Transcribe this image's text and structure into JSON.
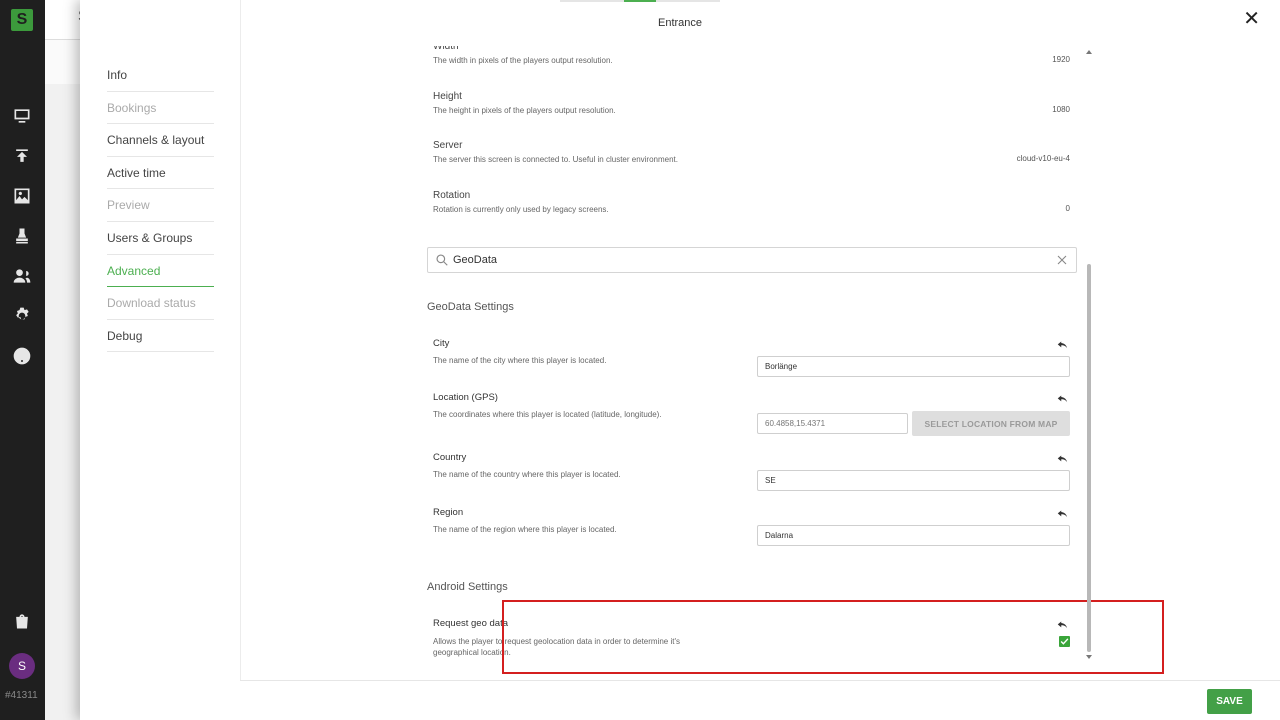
{
  "app": {
    "logo_letter": "S",
    "avatar_letter": "S",
    "account_id": "#41311"
  },
  "background": {
    "header_char": "S"
  },
  "modal": {
    "title": "Entrance",
    "close_label": "✕"
  },
  "left_nav": {
    "items": [
      {
        "label": "Info",
        "state": "normal"
      },
      {
        "label": "Bookings",
        "state": "disabled"
      },
      {
        "label": "Channels & layout",
        "state": "normal"
      },
      {
        "label": "Active time",
        "state": "normal"
      },
      {
        "label": "Preview",
        "state": "disabled"
      },
      {
        "label": "Users & Groups",
        "state": "normal"
      },
      {
        "label": "Advanced",
        "state": "active"
      },
      {
        "label": "Download status",
        "state": "disabled"
      },
      {
        "label": "Debug",
        "state": "normal"
      }
    ]
  },
  "settings": {
    "width": {
      "label": "Width",
      "description": "The width in pixels of the players output resolution.",
      "value": "1920"
    },
    "height": {
      "label": "Height",
      "description": "The height in pixels of the players output resolution.",
      "value": "1080"
    },
    "server": {
      "label": "Server",
      "description": "The server this screen is connected to. Useful in cluster environment.",
      "value": "cloud-v10-eu-4"
    },
    "rotation": {
      "label": "Rotation",
      "description": "Rotation is currently only used by legacy screens.",
      "value": "0"
    }
  },
  "search": {
    "value": "GeoData"
  },
  "geodata": {
    "heading": "GeoData Settings",
    "city": {
      "label": "City",
      "description": "The name of the city where this player is located.",
      "value": "Borlänge"
    },
    "location": {
      "label": "Location (GPS)",
      "description": "The coordinates where this player is located (latitude, longitude).",
      "placeholder": "60.4858,15.4371",
      "button": "SELECT LOCATION FROM MAP"
    },
    "country": {
      "label": "Country",
      "description": "The name of the country where this player is located.",
      "value": "SE"
    },
    "region": {
      "label": "Region",
      "description": "The name of the region where this player is located.",
      "value": "Dalarna"
    }
  },
  "android": {
    "heading": "Android Settings",
    "request_geo": {
      "label": "Request geo data",
      "description_line1": "Allows the player to request geolocation data in order to determine it's",
      "description_line2": "geographical location.",
      "checked": true
    }
  },
  "footer": {
    "save_label": "SAVE"
  },
  "colors": {
    "accent": "#4caf50",
    "highlight": "#d41f1f",
    "rail": "#1f1f1f"
  }
}
